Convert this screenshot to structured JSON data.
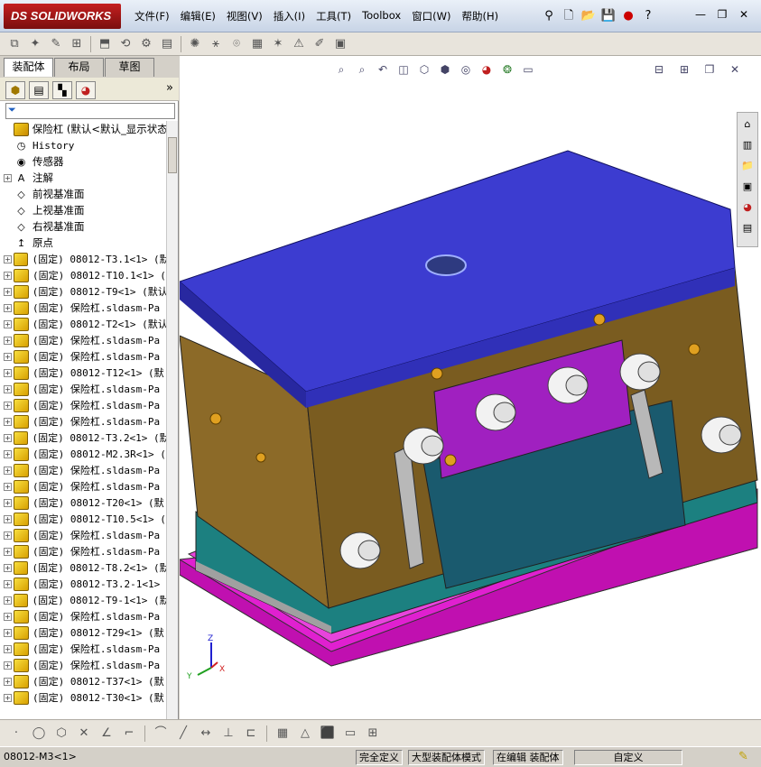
{
  "app": {
    "logo_text": "DS SOLIDWORKS"
  },
  "menu": [
    "文件(F)",
    "编辑(E)",
    "视图(V)",
    "插入(I)",
    "工具(T)",
    "Toolbox",
    "窗口(W)",
    "帮助(H)"
  ],
  "panel": {
    "tabs": [
      "装配体",
      "布局",
      "草图"
    ],
    "active_tab": "装配体",
    "filter_icon": "filter-icon"
  },
  "tree": {
    "root": "保险杠  (默认<默认_显示状态",
    "items": [
      {
        "label": "History",
        "icon": "history",
        "expand": false
      },
      {
        "label": "传感器",
        "icon": "sensor",
        "expand": false
      },
      {
        "label": "注解",
        "icon": "annotation",
        "expand": true
      },
      {
        "label": "前视基准面",
        "icon": "plane",
        "expand": false
      },
      {
        "label": "上视基准面",
        "icon": "plane",
        "expand": false
      },
      {
        "label": "右视基准面",
        "icon": "plane",
        "expand": false
      },
      {
        "label": "原点",
        "icon": "origin",
        "expand": false
      },
      {
        "label": "(固定) 08012-T3.1<1> (默",
        "icon": "part",
        "expand": true
      },
      {
        "label": "(固定) 08012-T10.1<1> (",
        "icon": "part",
        "expand": true
      },
      {
        "label": "(固定) 08012-T9<1> (默认",
        "icon": "part",
        "expand": true
      },
      {
        "label": "(固定) 保险杠.sldasm-Pa",
        "icon": "part",
        "expand": true
      },
      {
        "label": "(固定) 08012-T2<1> (默认",
        "icon": "part",
        "expand": true
      },
      {
        "label": "(固定) 保险杠.sldasm-Pa",
        "icon": "part",
        "expand": true
      },
      {
        "label": "(固定) 保险杠.sldasm-Pa",
        "icon": "part",
        "expand": true
      },
      {
        "label": "(固定) 08012-T12<1> (默",
        "icon": "part",
        "expand": true
      },
      {
        "label": "(固定) 保险杠.sldasm-Pa",
        "icon": "part",
        "expand": true
      },
      {
        "label": "(固定) 保险杠.sldasm-Pa",
        "icon": "part",
        "expand": true
      },
      {
        "label": "(固定) 保险杠.sldasm-Pa",
        "icon": "part",
        "expand": true
      },
      {
        "label": "(固定) 08012-T3.2<1> (默",
        "icon": "part",
        "expand": true
      },
      {
        "label": "(固定) 08012-M2.3R<1> (",
        "icon": "part",
        "expand": true
      },
      {
        "label": "(固定) 保险杠.sldasm-Pa",
        "icon": "part",
        "expand": true
      },
      {
        "label": "(固定) 保险杠.sldasm-Pa",
        "icon": "part",
        "expand": true
      },
      {
        "label": "(固定) 08012-T20<1> (默",
        "icon": "part",
        "expand": true
      },
      {
        "label": "(固定) 08012-T10.5<1> (",
        "icon": "part",
        "expand": true
      },
      {
        "label": "(固定) 保险杠.sldasm-Pa",
        "icon": "part",
        "expand": true
      },
      {
        "label": "(固定) 保险杠.sldasm-Pa",
        "icon": "part",
        "expand": true
      },
      {
        "label": "(固定) 08012-T8.2<1> (默",
        "icon": "part",
        "expand": true
      },
      {
        "label": "(固定) 08012-T3.2-1<1>",
        "icon": "part",
        "expand": true
      },
      {
        "label": "(固定) 08012-T9-1<1> (默",
        "icon": "part",
        "expand": true
      },
      {
        "label": "(固定) 保险杠.sldasm-Pa",
        "icon": "part",
        "expand": true
      },
      {
        "label": "(固定) 08012-T29<1> (默",
        "icon": "part",
        "expand": true
      },
      {
        "label": "(固定) 保险杠.sldasm-Pa",
        "icon": "part",
        "expand": true
      },
      {
        "label": "(固定) 保险杠.sldasm-Pa",
        "icon": "part",
        "expand": true
      },
      {
        "label": "(固定) 08012-T37<1> (默",
        "icon": "part",
        "expand": true
      },
      {
        "label": "(固定) 08012-T30<1> (默",
        "icon": "part",
        "expand": true
      }
    ]
  },
  "triad": {
    "x": "X",
    "y": "Y",
    "z": "Z"
  },
  "status": {
    "selected": "08012-M3<1>",
    "defined": "完全定义",
    "mode": "大型装配体模式",
    "editing": "在编辑 装配体",
    "custom": "自定义"
  },
  "colors": {
    "top_plate": "#3c3cd0",
    "mold_body": "#8c6a28",
    "slider_purple": "#a020c0",
    "plate_teal": "#1a6e6e",
    "base_magenta": "#e020d0",
    "cylinder": "#f0f0f0"
  }
}
